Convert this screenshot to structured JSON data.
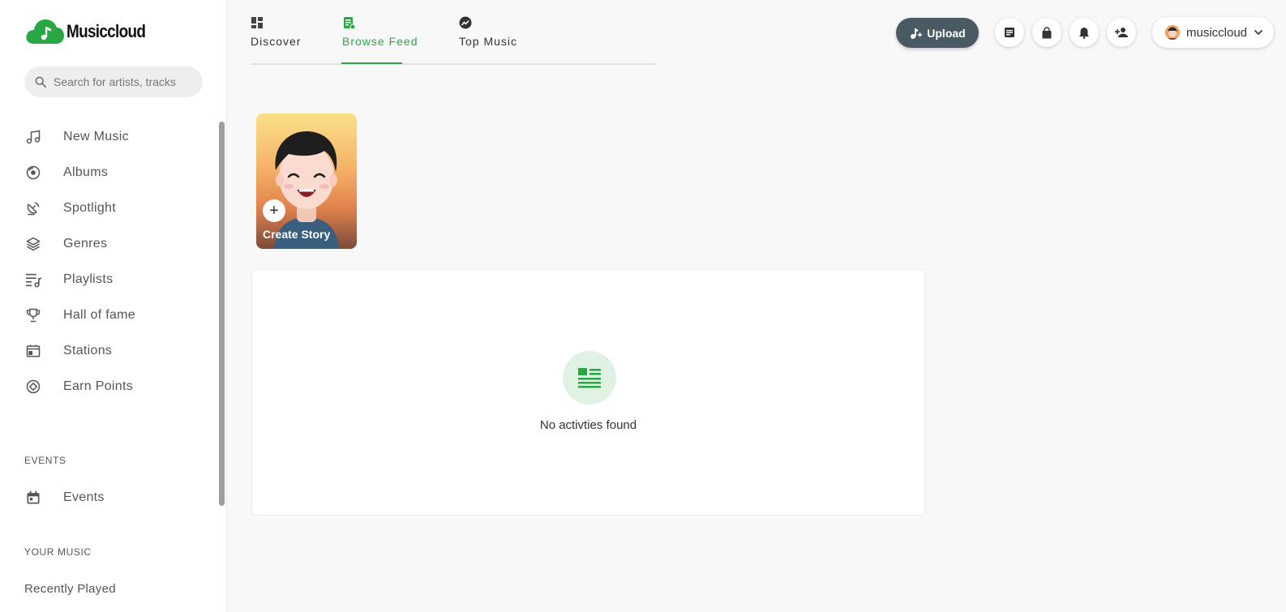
{
  "brand": {
    "name": "Musiccloud",
    "color": "#29a745"
  },
  "search": {
    "placeholder": "Search for artists, tracks"
  },
  "sidebar": {
    "items": [
      {
        "label": "New Music",
        "icon": "music-note-icon"
      },
      {
        "label": "Albums",
        "icon": "disc-icon"
      },
      {
        "label": "Spotlight",
        "icon": "satellite-dish-icon"
      },
      {
        "label": "Genres",
        "icon": "layers-icon"
      },
      {
        "label": "Playlists",
        "icon": "playlist-icon"
      },
      {
        "label": "Hall of fame",
        "icon": "trophy-icon"
      },
      {
        "label": "Stations",
        "icon": "radio-icon"
      },
      {
        "label": "Earn Points",
        "icon": "points-icon"
      }
    ],
    "events_section": {
      "title": "EVENTS",
      "items": [
        {
          "label": "Events",
          "icon": "calendar-icon"
        }
      ]
    },
    "music_section": {
      "title": "YOUR MUSIC",
      "items": [
        {
          "label": "Recently Played"
        }
      ]
    }
  },
  "tabs": [
    {
      "label": "Discover",
      "icon": "dashboard-icon",
      "active": false
    },
    {
      "label": "Browse Feed",
      "icon": "feed-icon",
      "active": true
    },
    {
      "label": "Top Music",
      "icon": "trending-icon",
      "active": false
    }
  ],
  "header": {
    "upload_label": "Upload",
    "icons": [
      "messages-icon",
      "shopping-bag-icon",
      "bell-icon",
      "add-user-icon"
    ],
    "username": "musiccloud"
  },
  "story": {
    "label": "Create Story",
    "plus": "+"
  },
  "feed": {
    "empty_text": "No activties found",
    "icon": "article-icon"
  }
}
